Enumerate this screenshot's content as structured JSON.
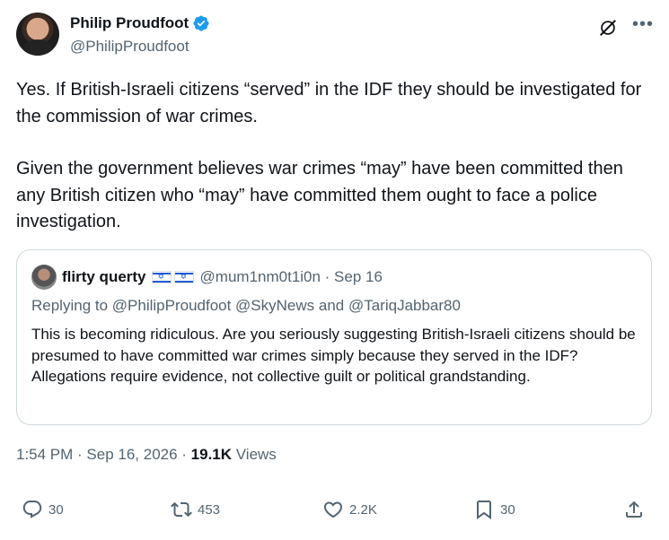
{
  "author": {
    "display_name": "Philip Proudfoot",
    "handle": "@PhilipProudfoot",
    "verified_color": "#1d9bf0"
  },
  "tweet": {
    "paragraph_1": "Yes. If British-Israeli citizens “served” in the IDF they should be investigated for the commission of war crimes.",
    "paragraph_2": "Given the government believes war crimes “may” have been committed then any British citizen who “may” have committed them ought to face a police  investigation."
  },
  "quote": {
    "display_name": "flirty querty",
    "handle_date": "@mum1nm0t1i0n · Sep 16",
    "replying_to": "Replying to @PhilipProudfoot @SkyNews and @TariqJabbar80",
    "body": "This is becoming ridiculous. Are you seriously suggesting British-Israeli citizens should be presumed to have committed war crimes simply because they served in the IDF? Allegations require evidence, not collective guilt or political grandstanding."
  },
  "meta": {
    "timestamp": "1:54 PM · Sep 16, 2026 · ",
    "views_count": "19.1K",
    "views_label": " Views"
  },
  "actions": {
    "replies": "30",
    "reposts": "453",
    "likes": "2.2K",
    "bookmarks": "30"
  },
  "icons": {
    "header": [
      "grok-icon",
      "more-icon"
    ],
    "actions": [
      "reply-icon",
      "repost-icon",
      "like-icon",
      "bookmark-icon",
      "share-icon"
    ]
  }
}
